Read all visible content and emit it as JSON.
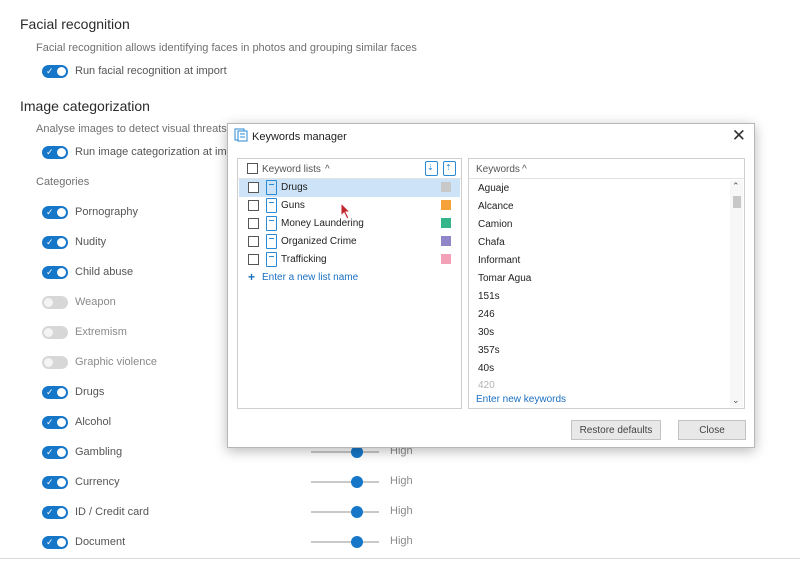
{
  "facial": {
    "title": "Facial recognition",
    "description": "Facial recognition allows identifying faces in photos and grouping similar faces",
    "run_label": "Run facial recognition at import"
  },
  "imagecat": {
    "title": "Image categorization",
    "description": "Analyse images to detect visual threats",
    "run_label": "Run image categorization at imp",
    "categories_title": "Categories"
  },
  "categories": [
    {
      "label": "Pornography",
      "enabled": true
    },
    {
      "label": "Nudity",
      "enabled": true
    },
    {
      "label": "Child abuse",
      "enabled": true
    },
    {
      "label": "Weapon",
      "enabled": false
    },
    {
      "label": "Extremism",
      "enabled": false
    },
    {
      "label": "Graphic violence",
      "enabled": false
    },
    {
      "label": "Drugs",
      "enabled": true
    },
    {
      "label": "Alcohol",
      "enabled": true
    },
    {
      "label": "Gambling",
      "enabled": true,
      "sensitivity": "High"
    },
    {
      "label": "Currency",
      "enabled": true,
      "sensitivity": "High"
    },
    {
      "label": "ID / Credit card",
      "enabled": true,
      "sensitivity": "High"
    },
    {
      "label": "Document",
      "enabled": true,
      "sensitivity": "High"
    }
  ],
  "dialog": {
    "title": "Keywords manager",
    "close_glyph": "✕",
    "lists_header": "Keyword lists",
    "keywords_header": "Keywords",
    "sort_glyph": "^",
    "lists": [
      {
        "name": "Drugs",
        "color": "#c8c8c8",
        "selected": true
      },
      {
        "name": "Guns",
        "color": "#f5a23a",
        "selected": false
      },
      {
        "name": "Money Laundering",
        "color": "#34b58a",
        "selected": false
      },
      {
        "name": "Organized Crime",
        "color": "#8e86c9",
        "selected": false
      },
      {
        "name": "Trafficking",
        "color": "#f2a1b6",
        "selected": false
      }
    ],
    "new_list_plus": "+",
    "new_list_label": "Enter a new list name",
    "keywords": [
      "Aguaje",
      "Alcance",
      "Camion",
      "Chafa",
      "Informant",
      "Tomar Agua",
      "151s",
      "246",
      "30s",
      "357s",
      "40s",
      "420"
    ],
    "new_keyword_label": "Enter new keywords",
    "restore_label": "Restore defaults",
    "close_label": "Close"
  }
}
